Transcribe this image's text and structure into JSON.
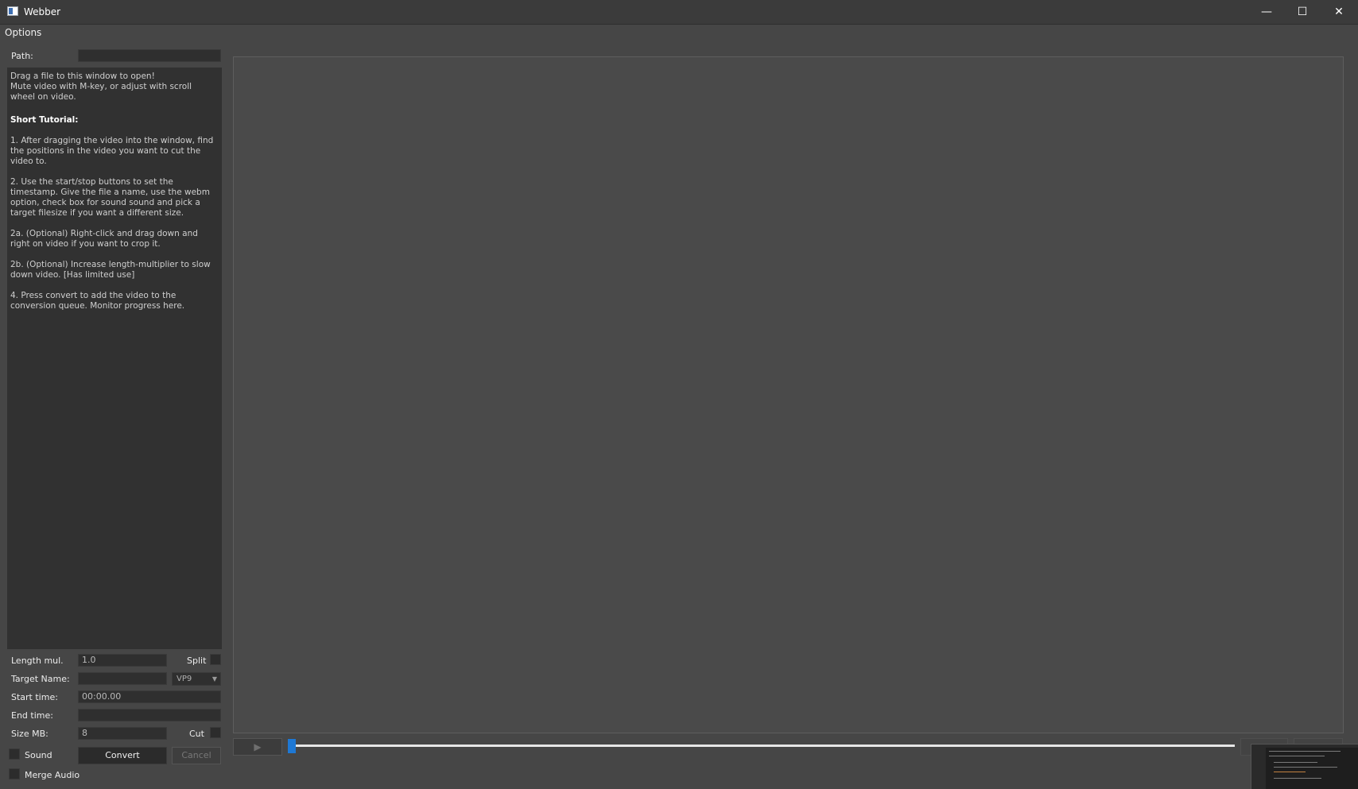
{
  "window": {
    "title": "Webber",
    "minimize_glyph": "—",
    "maximize_glyph": "☐",
    "close_glyph": "✕"
  },
  "menu": {
    "options_label": "Options"
  },
  "path": {
    "label": "Path:",
    "value": ""
  },
  "info": {
    "intro_1": "Drag a file to this window to open!",
    "intro_2": "Mute video with M-key, or adjust with scroll wheel on video.",
    "heading": "Short Tutorial:",
    "step_1": "1. After dragging the video into the window, find the positions in the video you want to cut the video to.",
    "step_2": "2. Use the start/stop buttons to set the timestamp. Give the file a name, use the webm option, check box for sound sound and pick a target filesize if you want a different size.",
    "step_2a": "2a. (Optional) Right-click and drag down and right on video if you want to crop it.",
    "step_2b": "2b. (Optional) Increase length-multiplier to slow down video. [Has limited use]",
    "step_4": "4. Press convert to add the video to the conversion queue. Monitor progress here."
  },
  "form": {
    "length_mul_label": "Length mul.",
    "length_mul_value": "1.0",
    "split_label": "Split",
    "target_name_label": "Target Name:",
    "target_name_value": "",
    "codec_value": "VP9",
    "start_time_label": "Start time:",
    "start_time_value": "00:00.00",
    "end_time_label": "End time:",
    "end_time_value": "",
    "size_mb_label": "Size MB:",
    "size_mb_value": "8",
    "cut_label": "Cut",
    "sound_label": "Sound",
    "convert_label": "Convert",
    "cancel_label": "Cancel",
    "merge_audio_label": "Merge Audio"
  },
  "player": {
    "play_glyph": "▶",
    "seek_position": 0.0
  },
  "colors": {
    "accent": "#1e78d4",
    "background": "#464646",
    "panel": "#313131"
  }
}
